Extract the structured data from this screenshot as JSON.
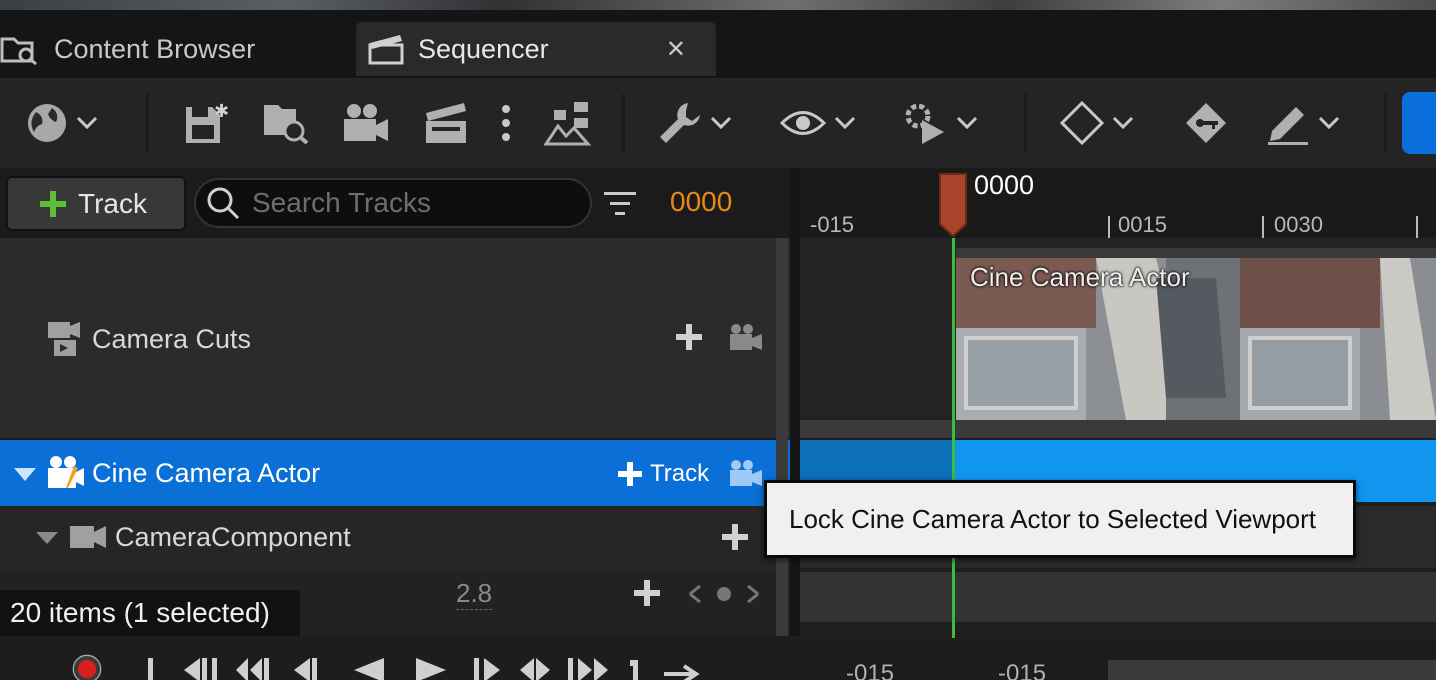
{
  "tabs": {
    "content_browser": "Content Browser",
    "sequencer": "Sequencer",
    "close_glyph": "✕"
  },
  "left": {
    "add_track_label": "Track",
    "search_placeholder": "Search Tracks",
    "frame_counter": "0000",
    "rows": {
      "camera_cuts": "Camera Cuts",
      "cine_camera_actor": "Cine Camera Actor",
      "cine_track_label": "Track",
      "camera_component": "CameraComponent",
      "aperture_value": "2.8"
    },
    "status": "20 items (1 selected)"
  },
  "timeline": {
    "playhead_frame": "0000",
    "ticks": [
      "-015",
      "0015",
      "0030"
    ],
    "section_label": "Cine Camera Actor",
    "bottom_left": "-015",
    "bottom_right": "-015"
  },
  "tooltip": "Lock Cine Camera Actor to Selected Viewport",
  "colors": {
    "selection_blue": "#0a6fd6",
    "lane_blue": "#1196f0",
    "frame_orange": "#e88a1a",
    "playhead": "#a8452a",
    "play_line": "#3bbd3b",
    "plus_green": "#5fbf3a"
  },
  "icons": [
    "world-icon",
    "save-icon",
    "find-asset-icon",
    "camera-icon",
    "clapper-icon",
    "more-icon",
    "hierarchy-icon",
    "wrench-icon",
    "eye-icon",
    "gear-play-icon",
    "key-diamond-icon",
    "key-icon",
    "pen-icon"
  ]
}
